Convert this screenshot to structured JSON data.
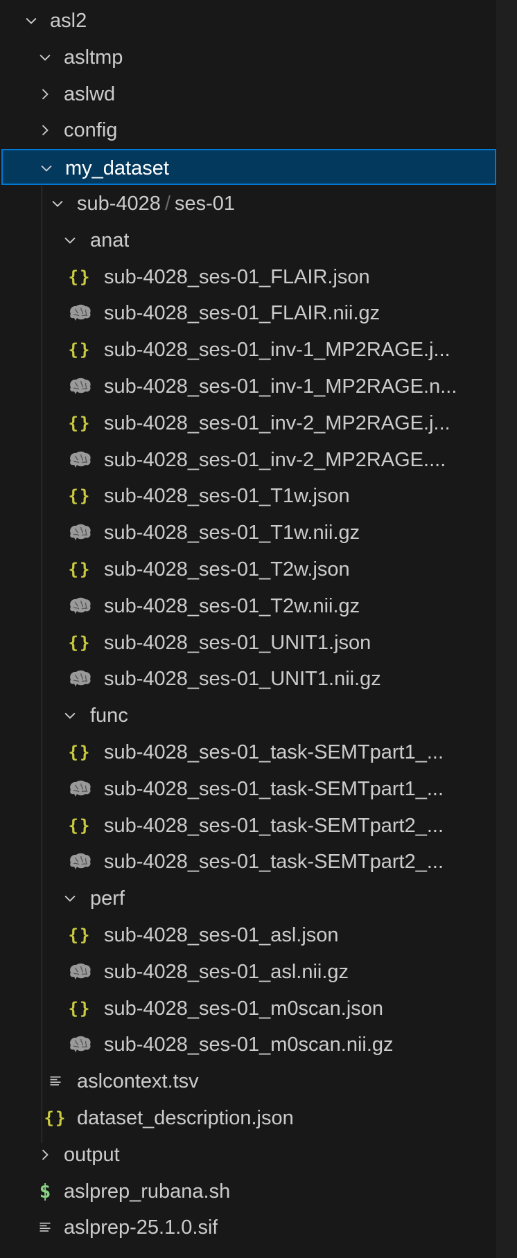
{
  "explorer": {
    "root": "asl2",
    "items": [
      {
        "label": "asl2",
        "type": "folder",
        "state": "open",
        "depth": 0
      },
      {
        "label": "asltmp",
        "type": "folder",
        "state": "open",
        "depth": 1
      },
      {
        "label": "aslwd",
        "type": "folder",
        "state": "closed",
        "depth": 1
      },
      {
        "label": "config",
        "type": "folder",
        "state": "closed",
        "depth": 1
      },
      {
        "label": "my_dataset",
        "type": "folder",
        "state": "open",
        "depth": 1,
        "selected": true
      },
      {
        "label": "sub-4028",
        "label2": "ses-01",
        "separator": "/",
        "type": "folder",
        "state": "open",
        "depth": 2
      },
      {
        "label": "anat",
        "type": "folder",
        "state": "open",
        "depth": 3
      },
      {
        "label": "sub-4028_ses-01_FLAIR.json",
        "type": "json",
        "depth": 4
      },
      {
        "label": "sub-4028_ses-01_FLAIR.nii.gz",
        "type": "nifti",
        "depth": 4
      },
      {
        "label": "sub-4028_ses-01_inv-1_MP2RAGE.j...",
        "type": "json",
        "depth": 4
      },
      {
        "label": "sub-4028_ses-01_inv-1_MP2RAGE.n...",
        "type": "nifti",
        "depth": 4
      },
      {
        "label": "sub-4028_ses-01_inv-2_MP2RAGE.j...",
        "type": "json",
        "depth": 4
      },
      {
        "label": "sub-4028_ses-01_inv-2_MP2RAGE....",
        "type": "nifti",
        "depth": 4
      },
      {
        "label": "sub-4028_ses-01_T1w.json",
        "type": "json",
        "depth": 4
      },
      {
        "label": "sub-4028_ses-01_T1w.nii.gz",
        "type": "nifti",
        "depth": 4
      },
      {
        "label": "sub-4028_ses-01_T2w.json",
        "type": "json",
        "depth": 4
      },
      {
        "label": "sub-4028_ses-01_T2w.nii.gz",
        "type": "nifti",
        "depth": 4
      },
      {
        "label": "sub-4028_ses-01_UNIT1.json",
        "type": "json",
        "depth": 4
      },
      {
        "label": "sub-4028_ses-01_UNIT1.nii.gz",
        "type": "nifti",
        "depth": 4
      },
      {
        "label": "func",
        "type": "folder",
        "state": "open",
        "depth": 3
      },
      {
        "label": "sub-4028_ses-01_task-SEMTpart1_...",
        "type": "json",
        "depth": 4
      },
      {
        "label": "sub-4028_ses-01_task-SEMTpart1_...",
        "type": "nifti",
        "depth": 4
      },
      {
        "label": "sub-4028_ses-01_task-SEMTpart2_...",
        "type": "json",
        "depth": 4
      },
      {
        "label": "sub-4028_ses-01_task-SEMTpart2_...",
        "type": "nifti",
        "depth": 4
      },
      {
        "label": "perf",
        "type": "folder",
        "state": "open",
        "depth": 3
      },
      {
        "label": "sub-4028_ses-01_asl.json",
        "type": "json",
        "depth": 4
      },
      {
        "label": "sub-4028_ses-01_asl.nii.gz",
        "type": "nifti",
        "depth": 4
      },
      {
        "label": "sub-4028_ses-01_m0scan.json",
        "type": "json",
        "depth": 4
      },
      {
        "label": "sub-4028_ses-01_m0scan.nii.gz",
        "type": "nifti",
        "depth": 4
      },
      {
        "label": "aslcontext.tsv",
        "type": "text",
        "depth": 2
      },
      {
        "label": "dataset_description.json",
        "type": "json",
        "depth": 2
      },
      {
        "label": "output",
        "type": "folder",
        "state": "closed",
        "depth": 1
      },
      {
        "label": "aslprep_rubana.sh",
        "type": "shell",
        "depth": 1
      },
      {
        "label": "aslprep-25.1.0.sif",
        "type": "text",
        "depth": 1
      }
    ]
  },
  "colors": {
    "background": "#181818",
    "text": "#cccccc",
    "selected_bg": "#04395e",
    "selected_border": "#0078d4",
    "json_icon": "#cbcb41",
    "shell_icon": "#89d185",
    "brain_icon": "#9a9a9a"
  }
}
